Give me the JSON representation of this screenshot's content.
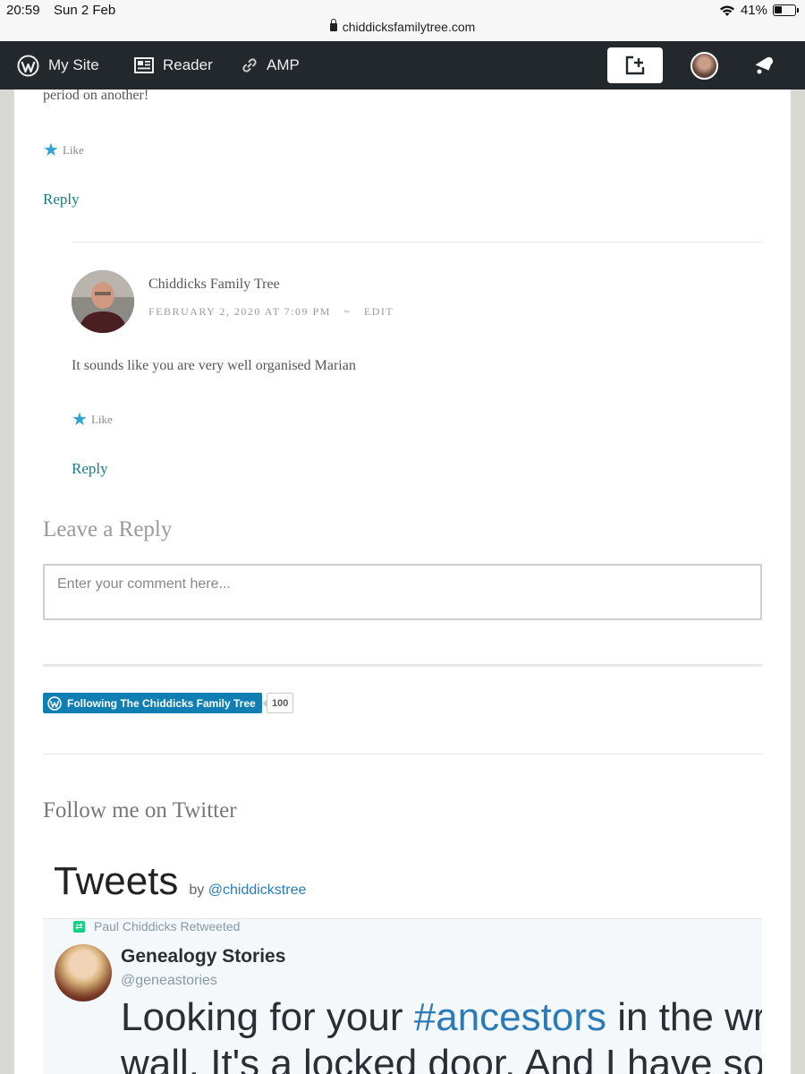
{
  "status_bar": {
    "time": "20:59",
    "date": "Sun 2 Feb",
    "battery": "41%",
    "url": "chiddicksfamilytree.com"
  },
  "admin_bar": {
    "my_site": "My Site",
    "reader": "Reader",
    "amp": "AMP"
  },
  "previous_comment": {
    "fragment": "period on another!",
    "like_label": "Like",
    "reply_label": "Reply"
  },
  "reply_comment": {
    "author": "Chiddicks Family Tree",
    "date": "FEBRUARY 2, 2020 AT 7:09 PM",
    "separator": "~",
    "edit_label": "EDIT",
    "body": "It sounds like you are very well organised Marian",
    "like_label": "Like",
    "reply_label": "Reply"
  },
  "leave_reply": {
    "heading": "Leave a Reply",
    "placeholder": "Enter your comment here..."
  },
  "follow": {
    "label": "Following The Chiddicks Family Tree",
    "count": "100"
  },
  "twitter_widget": {
    "heading": "Follow me on Twitter",
    "title": "Tweets",
    "by": "by",
    "handle": "@chiddickstree",
    "tweet": {
      "retweeted_by": "Paul Chiddicks Retweeted",
      "name": "Genealogy Stories",
      "username": "@geneastories",
      "text_before": "Looking for your ",
      "hashtag": "#ancestors",
      "text_after": " in the wrong",
      "line2": "wall. It's a locked door. And I have some"
    }
  },
  "colors": {
    "accent_teal": "#1a7a85",
    "star_blue": "#2ea3d0",
    "admin_bar": "#23282d",
    "follow_blue": "#0f7fb3",
    "twitter_blue": "#2b7bb9"
  }
}
